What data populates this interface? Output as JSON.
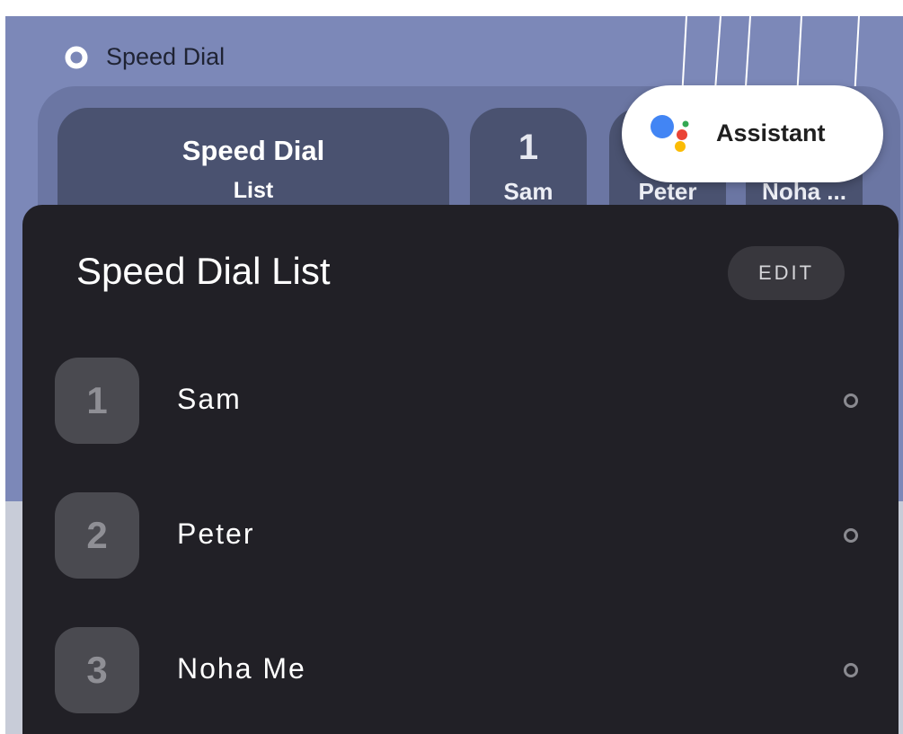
{
  "widget": {
    "title": "Speed Dial",
    "list_tile": {
      "line1": "Speed Dial",
      "line2": "List"
    },
    "contact_tiles": [
      {
        "number": "1",
        "name": "Sam"
      },
      {
        "number": "",
        "name": "Peter"
      },
      {
        "number": "",
        "name": "Noha ..."
      }
    ]
  },
  "assistant": {
    "label": "Assistant",
    "icon": "google-assistant-icon"
  },
  "sheet": {
    "title": "Speed Dial List",
    "edit_label": "EDIT",
    "entries": [
      {
        "number": "1",
        "name": "Sam"
      },
      {
        "number": "2",
        "name": "Peter"
      },
      {
        "number": "3",
        "name": "Noha Me"
      }
    ]
  },
  "colors": {
    "wallpaper": "#7c88b8",
    "tile": "#4a5270",
    "sheet": "#212026",
    "badge": "#4a4a50",
    "assistant_blue": "#4285f4",
    "assistant_red": "#ea4335",
    "assistant_yellow": "#fbbc05",
    "assistant_green": "#34a853"
  }
}
